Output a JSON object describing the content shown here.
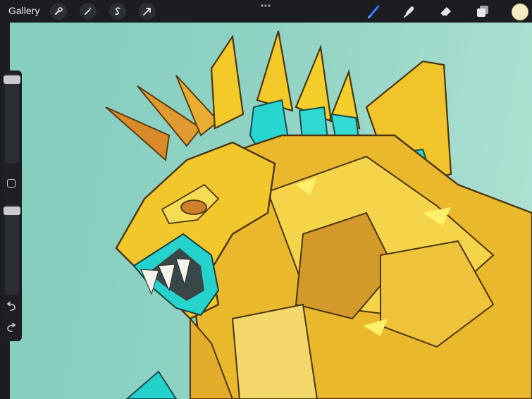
{
  "topbar": {
    "gallery_label": "Gallery",
    "tools_left": [
      "wrench-icon",
      "magic-wand-icon",
      "selection-icon",
      "transform-icon"
    ],
    "tools_right": [
      "brush-icon",
      "smudge-icon",
      "eraser-icon",
      "layers-icon"
    ],
    "active_tool": "brush-icon",
    "active_color": "#f3ecc2",
    "accent_color": "#2f7cf6"
  },
  "sidebar": {
    "brush_size_level": 0.03,
    "opacity_level": 0.02,
    "icons": [
      "modify-square-icon",
      "undo-icon",
      "redo-icon"
    ]
  },
  "canvas": {
    "background_color": "#8fd2c3"
  }
}
